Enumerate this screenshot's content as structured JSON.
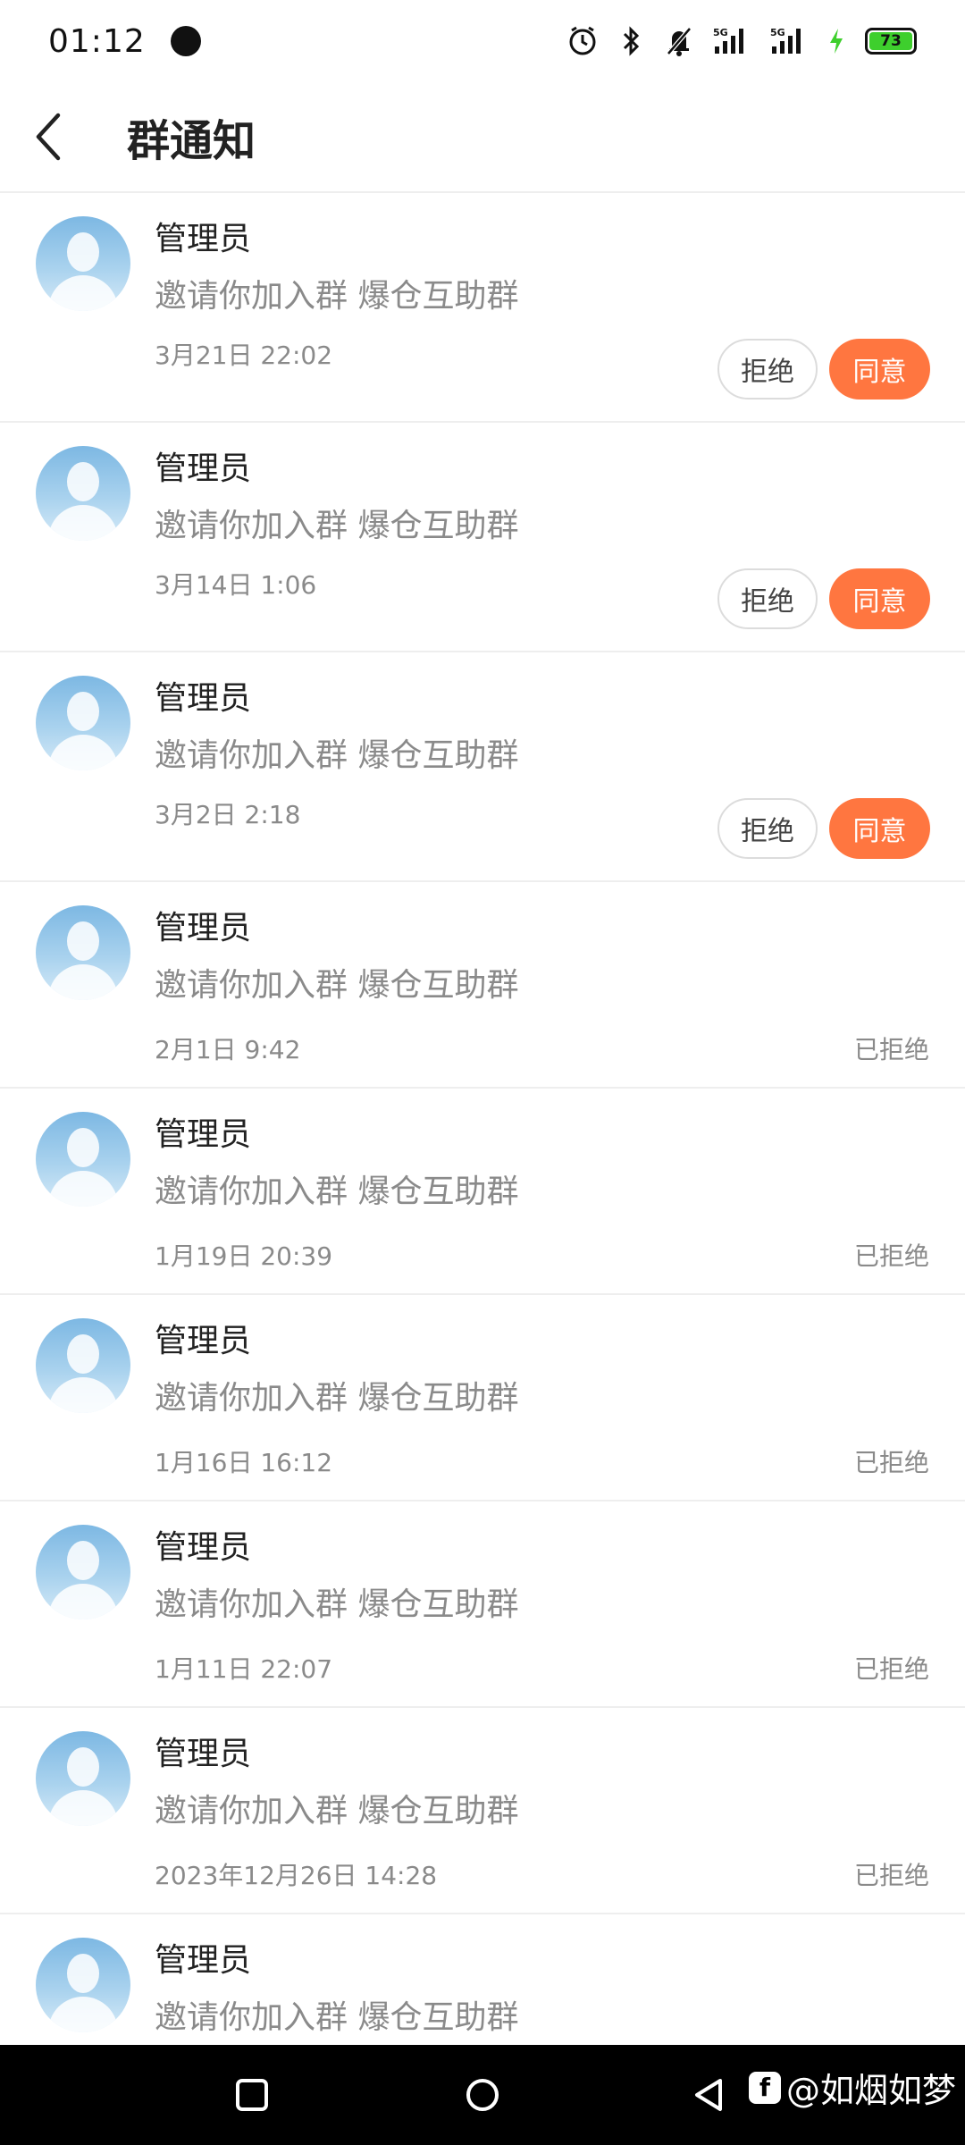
{
  "status_bar": {
    "time": "01:12",
    "battery": "73",
    "icons": [
      "alarm-icon",
      "bluetooth-icon",
      "mute-bell-icon",
      "signal-5g-icon",
      "signal-5g-icon",
      "charging-icon",
      "battery-icon"
    ]
  },
  "header": {
    "title": "群通知",
    "back_icon": "chevron-left-icon"
  },
  "buttons": {
    "reject": "拒绝",
    "accept": "同意"
  },
  "notifications": [
    {
      "sender": "管理员",
      "message": "邀请你加入群 爆仓互助群",
      "time": "3月21日 22:02",
      "status": ""
    },
    {
      "sender": "管理员",
      "message": "邀请你加入群 爆仓互助群",
      "time": "3月14日 1:06",
      "status": ""
    },
    {
      "sender": "管理员",
      "message": "邀请你加入群 爆仓互助群",
      "time": "3月2日 2:18",
      "status": ""
    },
    {
      "sender": "管理员",
      "message": "邀请你加入群 爆仓互助群",
      "time": "2月1日 9:42",
      "status": "已拒绝"
    },
    {
      "sender": "管理员",
      "message": "邀请你加入群 爆仓互助群",
      "time": "1月19日 20:39",
      "status": "已拒绝"
    },
    {
      "sender": "管理员",
      "message": "邀请你加入群 爆仓互助群",
      "time": "1月16日 16:12",
      "status": "已拒绝"
    },
    {
      "sender": "管理员",
      "message": "邀请你加入群 爆仓互助群",
      "time": "1月11日 22:07",
      "status": "已拒绝"
    },
    {
      "sender": "管理员",
      "message": "邀请你加入群 爆仓互助群",
      "time": "2023年12月26日 14:28",
      "status": "已拒绝"
    },
    {
      "sender": "管理员",
      "message": "邀请你加入群 爆仓互助群",
      "time": "",
      "status": ""
    }
  ],
  "nav_bar": {
    "icons": [
      "recents-square-icon",
      "home-circle-icon",
      "back-triangle-icon"
    ]
  },
  "watermark": {
    "logo": "f",
    "text": "@如烟如梦"
  },
  "colors": {
    "accent": "#ff7640",
    "secondary_text": "#8a8a8a",
    "divider": "#eeeeee"
  }
}
